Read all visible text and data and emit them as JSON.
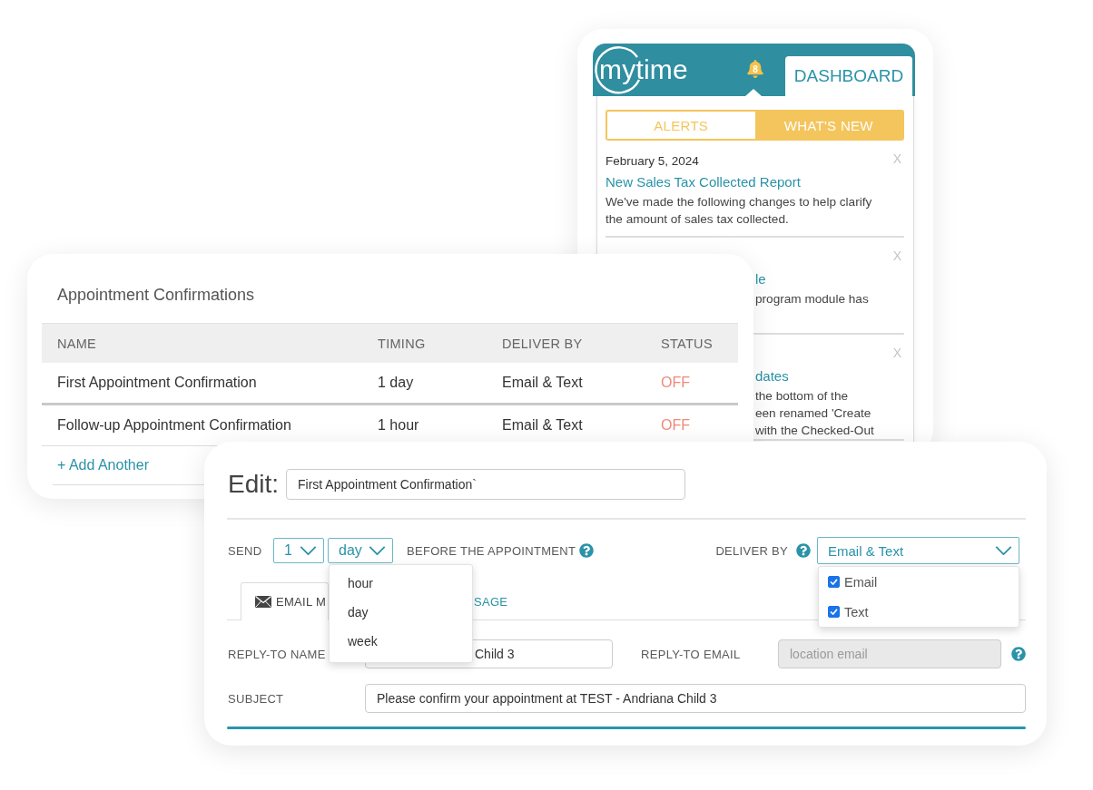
{
  "notifications_panel": {
    "logo": "mytime",
    "bell_count": "8",
    "nav_tab": {
      "label": "DASHBOARD",
      "selected": true
    },
    "tabs": [
      {
        "label": "ALERTS",
        "selected": false
      },
      {
        "label": "WHAT'S NEW",
        "selected": true
      }
    ],
    "items": [
      {
        "date": "February 5, 2024",
        "close": "X",
        "title": "New Sales Tax Collected Report",
        "body_lines": [
          "We've made the following changes to help clarify",
          "the amount of sales tax collected."
        ]
      },
      {
        "close": "X",
        "title": "le",
        "body_lines": [
          "program module has"
        ]
      },
      {
        "close": "X",
        "title": "dates",
        "body_lines": [
          "the bottom of the",
          "een renamed 'Create",
          "with the Checked-Out"
        ]
      }
    ]
  },
  "confirmations": {
    "title": "Appointment Confirmations",
    "columns": [
      "NAME",
      "TIMING",
      "DELIVER BY",
      "STATUS"
    ],
    "rows": [
      {
        "name": "First Appointment Confirmation",
        "timing": "1 day",
        "deliver_by": "Email & Text",
        "status": "OFF",
        "on": false
      },
      {
        "name": "Follow-up Appointment Confirmation",
        "timing": "1 hour",
        "deliver_by": "Email & Text",
        "status": "OFF",
        "on": false
      }
    ],
    "add_link": "+ Add Another"
  },
  "edit_form": {
    "heading": "Edit:",
    "name_field": {
      "value": "First Appointment Confirmation`"
    },
    "send_label": "SEND",
    "count_select": {
      "value": "1"
    },
    "unit_select": {
      "value": "day",
      "expanded": true,
      "options": [
        "hour",
        "day",
        "week"
      ]
    },
    "before_label": "BEFORE THE APPOINTMENT",
    "deliver_label": "DELIVER BY",
    "deliver_select": {
      "value": "Email & Text",
      "expanded": true,
      "options": [
        {
          "label": "Email",
          "checked": true
        },
        {
          "label": "Text",
          "checked": true
        }
      ]
    },
    "tabs": [
      {
        "label": "EMAIL M",
        "selected": true
      },
      {
        "label": "SAGE",
        "selected": false
      }
    ],
    "reply_name": {
      "label": "REPLY-TO NAME",
      "value": "Child 3"
    },
    "reply_email": {
      "label": "REPLY-TO EMAIL",
      "placeholder": "location email",
      "disabled": true
    },
    "subject": {
      "label": "SUBJECT",
      "value": "Please confirm your appointment at TEST - Andriana Child 3"
    }
  }
}
